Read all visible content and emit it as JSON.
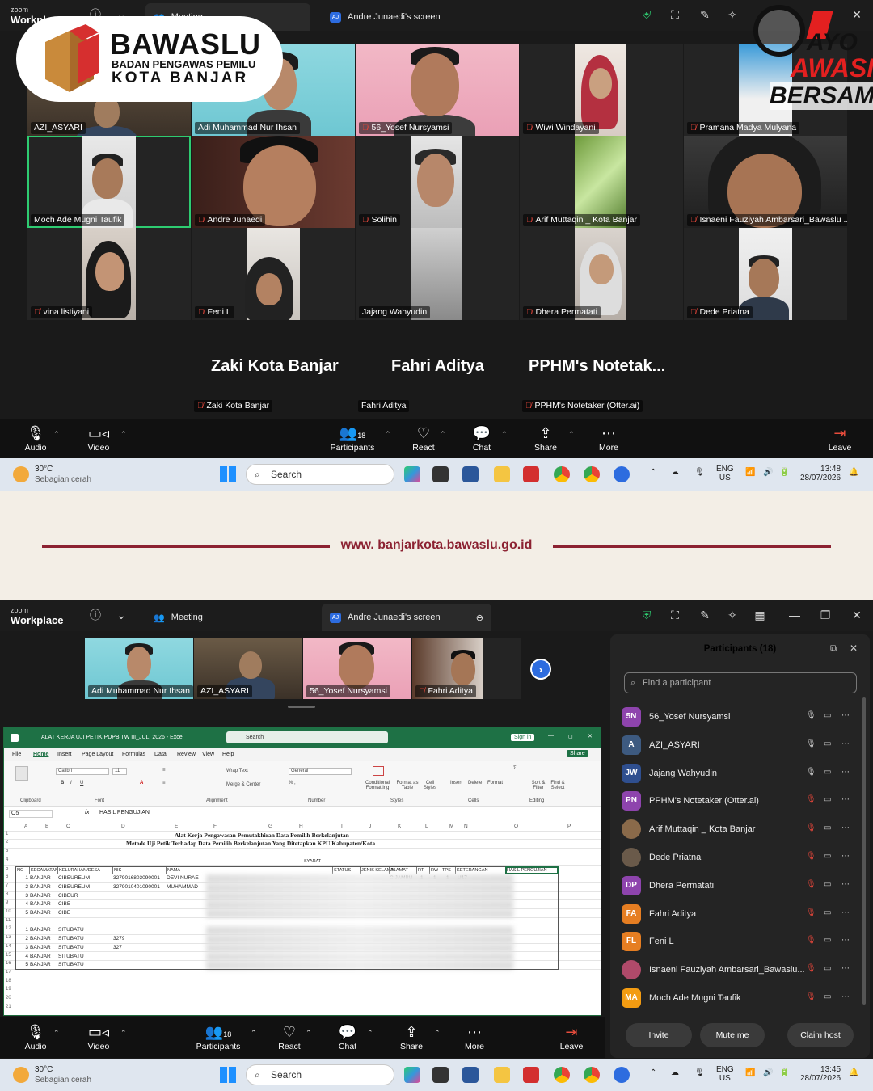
{
  "zoom": {
    "brand_small": "zoom",
    "brand_big": "Workplace",
    "meeting_tab": "Meeting",
    "screen_tab": "Andre Junaedi's screen",
    "screen_badge": "AJ"
  },
  "banner": {
    "org": "BAWASLU",
    "org_sub1": "BADAN PENGAWAS PEMILU",
    "org_sub2": "KOTA BANJAR",
    "campaign_1": "AYO",
    "campaign_2": "AWASI",
    "campaign_3": "BERSAMA",
    "url": "www. banjarkota.bawaslu.go.id"
  },
  "gallery": {
    "tiles": [
      {
        "name": "AZI_ASYARI",
        "muted": false
      },
      {
        "name": "Adi Muhammad Nur Ihsan",
        "muted": false
      },
      {
        "name": "56_Yosef Nursyamsi",
        "muted": true
      },
      {
        "name": "Wiwi Windayani",
        "muted": true
      },
      {
        "name": "Pramana Madya Mulyana",
        "muted": true
      },
      {
        "name": "Moch Ade Mugni Taufik",
        "muted": false
      },
      {
        "name": "Andre Junaedi",
        "muted": true
      },
      {
        "name": "Solihin",
        "muted": true
      },
      {
        "name": "Arif Muttaqin _ Kota Banjar",
        "muted": true
      },
      {
        "name": "Isnaeni Fauziyah Ambarsari_Bawaslu ...",
        "muted": true
      },
      {
        "name": "vina listiyani",
        "muted": true
      },
      {
        "name": "Feni L",
        "muted": true
      },
      {
        "name": "Jajang Wahyudin",
        "muted": false
      },
      {
        "name": "Dhera Permatati",
        "muted": true
      },
      {
        "name": "Dede Priatna",
        "muted": true
      }
    ],
    "no_video": [
      {
        "big": "Zaki Kota Banjar",
        "name": "Zaki Kota Banjar",
        "muted": true
      },
      {
        "big": "Fahri Aditya",
        "name": "Fahri Aditya",
        "muted": false
      },
      {
        "big": "PPHM's  Notetak...",
        "name": "PPHM's Notetaker (Otter.ai)",
        "muted": true
      }
    ]
  },
  "controls": {
    "audio": "Audio",
    "video": "Video",
    "participants": "Participants",
    "participants_count": "18",
    "react": "React",
    "chat": "Chat",
    "share": "Share",
    "more": "More",
    "leave": "Leave"
  },
  "taskbar1": {
    "temp": "30°C",
    "weather": "Sebagian cerah",
    "search": "Search",
    "lang1": "ENG",
    "lang2": "US",
    "time": "13:48",
    "date": "28/07/2026"
  },
  "taskbar2": {
    "temp": "30°C",
    "weather": "Sebagian cerah",
    "search": "Search",
    "lang1": "ENG",
    "lang2": "US",
    "time": "13:45",
    "date": "28/07/2026"
  },
  "filmstrip": [
    "Adi Muhammad Nur Ihsan",
    "AZI_ASYARI",
    "56_Yosef Nursyamsi",
    "Fahri Aditya"
  ],
  "excel": {
    "window_title": "ALAT KERJA UJI PETIK PDPB TW III_JULI 2026  -  Excel",
    "search": "Search",
    "signin": "Sign in",
    "share": "Share",
    "menu": [
      "File",
      "Home",
      "Insert",
      "Page Layout",
      "Formulas",
      "Data",
      "Review",
      "View",
      "Help"
    ],
    "groups": [
      "Clipboard",
      "Font",
      "Alignment",
      "Number",
      "Styles",
      "Cells",
      "Editing"
    ],
    "font_name": "Calibri",
    "font_size": "11",
    "number_format": "General",
    "wrap_text": "Wrap Text",
    "merge_center": "Merge & Center",
    "styles": [
      "Conditional Formatting",
      "Format as Table",
      "Cell Styles"
    ],
    "cells": [
      "Insert",
      "Delete",
      "Format"
    ],
    "editing": [
      "Sort & Filter",
      "Find & Select"
    ],
    "name_box": "O5",
    "formula": "HASIL PENGUJIAN",
    "columns": [
      "A",
      "B",
      "C",
      "D",
      "E",
      "F",
      "G",
      "H",
      "I",
      "J",
      "K",
      "L",
      "M",
      "N",
      "O",
      "P"
    ],
    "title1": "Alat Kerja Pengawasan Pemutakhiran Data Pemilih Berkelanjutan",
    "title2": "Metode Uji Petik Terhadap Data Pemilih Berkelanjutan Yang Ditetapkan KPU Kabupaten/Kota",
    "syarat": "SYARAT",
    "headers": [
      "NO",
      "KECAMATAN",
      "KELURAHAN/DESA",
      "NIK",
      "NAMA",
      "STATUS",
      "JENIS KELAMIN",
      "ALAMAT",
      "RT",
      "RW",
      "TPS",
      "KETERANGAN",
      "HASIL PENGUJIAN"
    ],
    "rows": [
      {
        "no": "1",
        "kec": "BANJAR",
        "desa": "CIBEUREUM",
        "nik": "3279016803090001",
        "nama": "DEVI NURAE",
        "alamat": "CIJAMBU",
        "rt": "1",
        "rw": "1",
        "tps": "1",
        "ket": "U17"
      },
      {
        "no": "2",
        "kec": "BANJAR",
        "desa": "CIBEUREUM",
        "nik": "3279010401090001",
        "nama": "MUHAMMAD",
        "alamat": "",
        "rt": "",
        "rw": "",
        "tps": "",
        "ket": ""
      },
      {
        "no": "3",
        "kec": "BANJAR",
        "desa": "CIBEUR",
        "nik": "",
        "nama": "",
        "alamat": "",
        "rt": "",
        "rw": "",
        "tps": "",
        "ket": ""
      },
      {
        "no": "4",
        "kec": "BANJAR",
        "desa": "CIBE",
        "nik": "",
        "nama": "",
        "alamat": "",
        "rt": "",
        "rw": "",
        "tps": "",
        "ket": ""
      },
      {
        "no": "5",
        "kec": "BANJAR",
        "desa": "CIBE",
        "nik": "",
        "nama": "",
        "alamat": "",
        "rt": "",
        "rw": "",
        "tps": "",
        "ket": ""
      },
      {
        "no": "1",
        "kec": "BANJAR",
        "desa": "SITUBATU",
        "nik": "",
        "nama": "",
        "alamat": "",
        "rt": "",
        "rw": "",
        "tps": "",
        "ket": ""
      },
      {
        "no": "2",
        "kec": "BANJAR",
        "desa": "SITUBATU",
        "nik": "3279",
        "nama": "",
        "alamat": "",
        "rt": "",
        "rw": "",
        "tps": "",
        "ket": ""
      },
      {
        "no": "3",
        "kec": "BANJAR",
        "desa": "SITUBATU",
        "nik": "327",
        "nama": "",
        "alamat": "",
        "rt": "",
        "rw": "",
        "tps": "",
        "ket": ""
      },
      {
        "no": "4",
        "kec": "BANJAR",
        "desa": "SITUBATU",
        "nik": "",
        "nama": "",
        "alamat": "",
        "rt": "",
        "rw": "",
        "tps": "",
        "ket": ""
      },
      {
        "no": "5",
        "kec": "BANJAR",
        "desa": "SITUBATU",
        "nik": "",
        "nama": "",
        "alamat": "",
        "rt": "",
        "rw": "",
        "tps": "",
        "ket": ""
      }
    ]
  },
  "panel": {
    "title": "Participants (18)",
    "search_placeholder": "Find a participant",
    "participants": [
      {
        "initials": "5N",
        "name": "56_Yosef Nursyamsi",
        "color": "#8e44ad",
        "mic_muted": false,
        "cam_off": true
      },
      {
        "initials": "A",
        "name": "AZI_ASYARI",
        "color": "#3d5a80",
        "mic_muted": false,
        "cam_off": true
      },
      {
        "initials": "JW",
        "name": "Jajang Wahyudin",
        "color": "#2f4f8f",
        "mic_muted": false,
        "cam_off": true
      },
      {
        "initials": "PN",
        "name": "PPHM's Notetaker (Otter.ai)",
        "color": "#8e44ad",
        "mic_muted": true,
        "cam_off": true
      },
      {
        "initials": "",
        "name": "Arif Muttaqin _ Kota Banjar",
        "color": "#8a6a4a",
        "mic_muted": true,
        "cam_off": true
      },
      {
        "initials": "",
        "name": "Dede Priatna",
        "color": "#6a5a4a",
        "mic_muted": true,
        "cam_off": true
      },
      {
        "initials": "DP",
        "name": "Dhera Permatati",
        "color": "#8e44ad",
        "mic_muted": true,
        "cam_off": true
      },
      {
        "initials": "FA",
        "name": "Fahri Aditya",
        "color": "#e67e22",
        "mic_muted": true,
        "cam_off": true
      },
      {
        "initials": "FL",
        "name": "Feni L",
        "color": "#e67e22",
        "mic_muted": true,
        "cam_off": true
      },
      {
        "initials": "",
        "name": "Isnaeni Fauziyah Ambarsari_Bawaslu...",
        "color": "#b04a6a",
        "mic_muted": true,
        "cam_off": true
      },
      {
        "initials": "MA",
        "name": "Moch Ade Mugni Taufik",
        "color": "#f39c12",
        "mic_muted": true,
        "cam_off": true
      }
    ],
    "invite": "Invite",
    "mute_me": "Mute me",
    "claim_host": "Claim host"
  }
}
